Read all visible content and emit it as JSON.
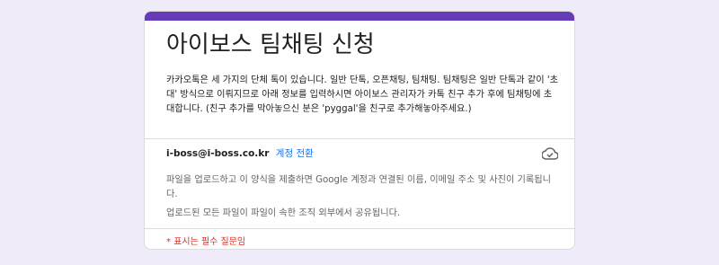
{
  "form": {
    "title": "아이보스 팀채팅 신청",
    "description": "카카오톡은 세 가지의 단체 톡이 있습니다. 일반 단톡, 오픈채팅, 팀채팅. 팀채팅은 일반 단톡과 같이 '초대' 방식으로 이뤄지므로 아래 정보를 입력하시면 아이보스 관리자가 카톡 친구 추가 후에 팀채팅에 초대합니다. (친구 추가를 막아놓으신 분은 'pyggal'을 친구로 추가해놓아주세요.)",
    "account_email": "i-boss@i-boss.co.kr",
    "switch_account_label": "계정 전환",
    "upload_notice": "파일을 업로드하고 이 양식을 제출하면 Google 계정과 연결된 이름, 이메일 주소 및 사진이 기록됩니다.",
    "share_notice": "업로드된 모든 파일이 파일이 속한 조직 외부에서 공유됩니다.",
    "required_note": "* 표시는 필수 질문임"
  },
  "icons": {
    "save_status": "cloud-check-icon"
  },
  "colors": {
    "accent": "#673ab7",
    "background": "#f0ebf8",
    "link": "#1a73e8",
    "required": "#d93025"
  }
}
